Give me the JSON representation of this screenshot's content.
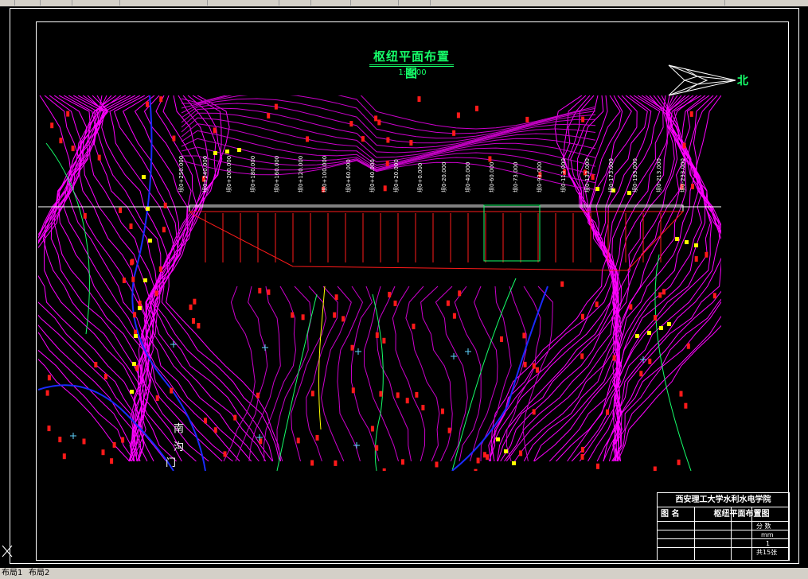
{
  "drawing": {
    "title": "枢纽平面布置图",
    "scale": "1:1000",
    "north_label": "北",
    "place_labels": [
      "南",
      "沟",
      "门"
    ],
    "station_labels": [
      "坝0+250.000",
      "坝0+240.000",
      "坝0+200.000",
      "坝0+180.000",
      "坝0+160.000",
      "坝0+120.000",
      "坝0+100.000",
      "坝0+60.000",
      "坝0+40.000",
      "坝0+20.000",
      "坝0+0.000",
      "坝0-20.000",
      "坝0-40.000",
      "坝0-60.000",
      "坝0-73.000",
      "坝0-93.000",
      "坝0-113.000",
      "坝0-133.000",
      "坝0-173.000",
      "坝0-193.000",
      "坝0-213.000",
      "坝0-233.000"
    ]
  },
  "title_block": {
    "institution": "西安理工大学水利水电学院",
    "label_name": "图 名",
    "drawing_name": "枢纽平面布置图",
    "unit_value": "mm",
    "scale_label": "分 数",
    "sheet_value": "1",
    "sheet_total": "共15张"
  },
  "layout_tabs": [
    "布局1",
    "布局2"
  ],
  "colors": {
    "background": "#000000",
    "contour_magenta": "#ff00ff",
    "contour_green": "#16ff6a",
    "marker_red": "#ff1a1a",
    "marker_yellow": "#ffff00",
    "river_blue": "#1a2bff",
    "frame_white": "#ffffff"
  }
}
